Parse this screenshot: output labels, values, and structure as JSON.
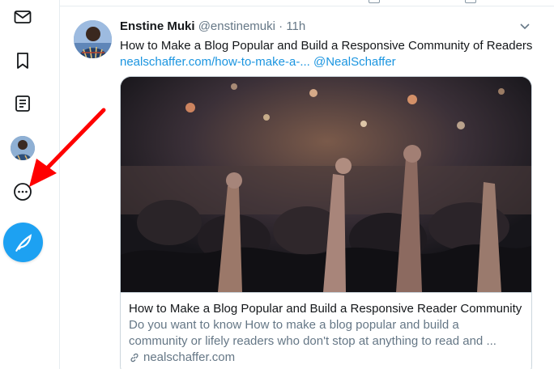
{
  "sidebar": {
    "icons": [
      "envelope-icon",
      "bookmark-icon",
      "lists-icon",
      "profile-avatar",
      "more-options-icon",
      "compose-tweet-icon"
    ],
    "accent_color": "#1da1f2"
  },
  "tweet": {
    "author_name": "Enstine Muki",
    "author_handle": "@enstinemuki",
    "separator": "·",
    "time": "11h",
    "text": "How to Make a Blog Popular and Build a Responsive Community of Readers",
    "link": "nealschaffer.com/how-to-make-a-...",
    "mention": "@NealSchaffer",
    "card": {
      "title": "How to Make a Blog Popular and Build a Responsive Reader Community",
      "description_line1": "Do you want to know How to make a blog popular and build a",
      "description_line2": "community or lifely readers who don't stop at anything to read and ...",
      "domain": "nealschaffer.com"
    }
  },
  "annotation": {
    "arrow_color": "#ff0000"
  }
}
